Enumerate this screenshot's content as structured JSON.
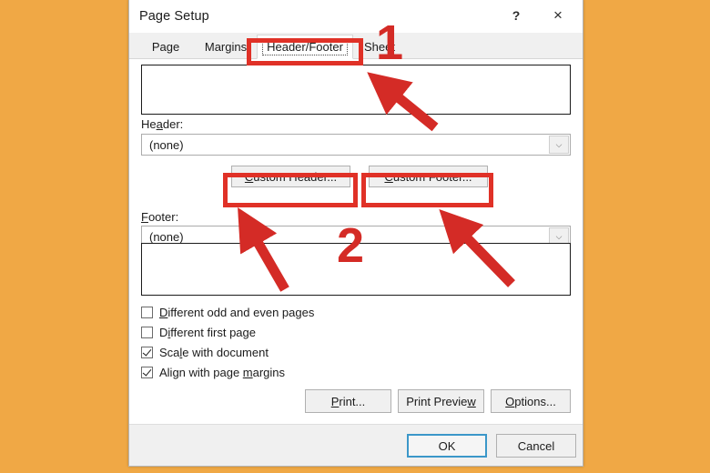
{
  "window": {
    "title": "Page Setup",
    "help_icon": "question-mark-icon",
    "close_icon": "close-x-icon",
    "help_label": "?",
    "close_label": "×"
  },
  "tabs": [
    {
      "label": "Page",
      "selected": false
    },
    {
      "label": "Margins",
      "selected": false
    },
    {
      "label": "Header/Footer",
      "selected": true
    },
    {
      "label": "Sheet",
      "selected": false
    }
  ],
  "header_section": {
    "label": "Header:",
    "label_accel_prefix": "He",
    "label_accel_char": "a",
    "label_accel_suffix": "der:",
    "value": "(none)",
    "dropdown_icon": "chevron-down-icon",
    "dropdown_glyph": "⌵"
  },
  "footer_section": {
    "label": "Footer:",
    "label_accel_prefix": "",
    "label_accel_char": "F",
    "label_accel_suffix": "ooter:",
    "value": "(none)",
    "dropdown_icon": "chevron-down-icon",
    "dropdown_glyph": "⌵"
  },
  "custom_buttons": {
    "header": {
      "label": "Custom Header...",
      "accel_prefix": "",
      "accel_char": "C",
      "accel_suffix": "ustom Header..."
    },
    "footer": {
      "label": "Custom Footer...",
      "accel_prefix": "",
      "accel_char": "C",
      "accel_suffix": "ustom Footer..."
    }
  },
  "checkboxes": [
    {
      "label": "Different odd and even pages",
      "checked": false,
      "accel_prefix": "",
      "accel_char": "D",
      "accel_suffix": "ifferent odd and even pages"
    },
    {
      "label": "Different first page",
      "checked": false,
      "accel_prefix": "D",
      "accel_char": "i",
      "accel_suffix": "fferent first page"
    },
    {
      "label": "Scale with document",
      "checked": true,
      "accel_prefix": "Sca",
      "accel_char": "l",
      "accel_suffix": "e with document"
    },
    {
      "label": "Align with page margins",
      "checked": true,
      "accel_prefix": "Align with page ",
      "accel_char": "m",
      "accel_suffix": "argins"
    }
  ],
  "action_buttons": [
    {
      "label": "Print...",
      "accel_prefix": "",
      "accel_char": "P",
      "accel_suffix": "rint..."
    },
    {
      "label": "Print Preview",
      "accel_prefix": "Print Previe",
      "accel_char": "w",
      "accel_suffix": ""
    },
    {
      "label": "Options...",
      "accel_prefix": "",
      "accel_char": "O",
      "accel_suffix": "ptions..."
    }
  ],
  "footer_buttons": {
    "ok": "OK",
    "cancel": "Cancel"
  },
  "annotations": {
    "step_one": "1",
    "step_two": "2",
    "highlight_color": "#E03127",
    "number_color": "#D42B26"
  },
  "colors": {
    "page_background": "#F0A845",
    "dialog_background": "#FFFFFF",
    "footer_bar": "#F0F0F0",
    "focus_border": "#3B97C9",
    "annotation_red": "#E03127"
  }
}
